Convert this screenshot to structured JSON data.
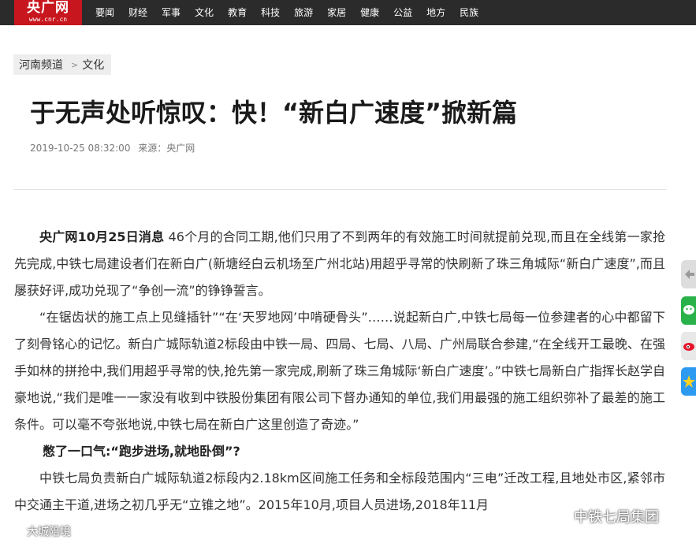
{
  "header": {
    "logo_text": "央广网",
    "logo_domain": "www.cnr.cn",
    "nav": [
      "要闻",
      "财经",
      "军事",
      "文化",
      "教育",
      "科技",
      "旅游",
      "家居",
      "健康",
      "公益",
      "地方",
      "民族"
    ]
  },
  "breadcrumb": {
    "channel": "河南频道",
    "separator": ">",
    "section": "文化"
  },
  "article": {
    "title": "于无声处听惊叹：快！“新白广速度”掀新篇",
    "datetime": "2019-10-25 08:32:00",
    "source": "来源：央广网",
    "p1_lead": "央广网10月25日消息",
    "p1_body": "  46个月的合同工期,他们只用了不到两年的有效施工时间就提前兑现,而且在全线第一家抢先完成,中铁七局建设者们在新白广(新塘经白云机场至广州北站)用超乎寻常的快刷新了珠三角城际“新白广速度”,而且屡获好评,成功兑现了“争创一流”的铮铮誓言。",
    "p2": "“在锯齿状的施工点上见缝插针”“在‘天罗地网’中啃硬骨头”……说起新白广,中铁七局每一位参建者的心中都留下了刻骨铭心的记忆。新白广城际轨道2标段由中铁一局、四局、七局、八局、广州局联合参建,“在全线开工最晚、在强手如林的拼抢中,我们用超乎寻常的快,抢先第一家完成,刷新了珠三角城际‘新白广速度’。”中铁七局新白广指挥长赵学自豪地说,“我们是唯一一家没有收到中铁股份集团有限公司下督办通知的单位,我们用最强的施工组织弥补了最差的施工条件。可以毫不夸张地说,中铁七局在新白广这里创造了奇迹。”",
    "subhead": "憋了一口气:“跑步进场,就地卧倒”?",
    "p3": "中铁七局负责新白广城际轨道2标段内2.18km区间施工任务和全标段范围内“三电”迁改工程,且地处市区,紧邻市中交通主干道,进场之初几乎无“立锥之地”。2015年10月,项目人员进场,2018年11月"
  },
  "sidebar": [
    "share-top",
    "wechat-share",
    "weibo-share",
    "qzone-share"
  ],
  "watermarks": {
    "right": "中铁七局集团",
    "left": "大城陪境"
  }
}
